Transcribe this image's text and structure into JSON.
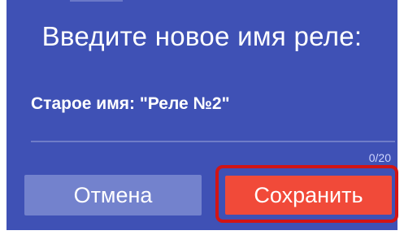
{
  "dialog": {
    "title": "Введите новое имя реле:",
    "old_name_label": "Старое имя: \"Реле №2\"",
    "input_value": "",
    "char_counter": "0/20",
    "cancel_label": "Отмена",
    "save_label": "Сохранить"
  },
  "colors": {
    "dialog_bg": "#3f51b5",
    "cancel_button": "#7382cd",
    "save_button": "#f14a39",
    "highlight_outline": "#d21414"
  }
}
